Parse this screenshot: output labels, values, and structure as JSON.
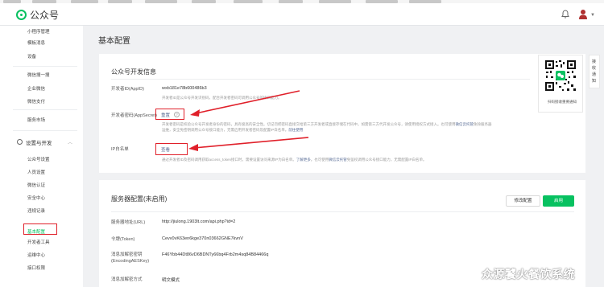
{
  "header": {
    "logo_text": "公众号"
  },
  "sidebar": {
    "items": [
      {
        "label": "小程序管理"
      },
      {
        "label": "模板消息"
      },
      {
        "label": "设备"
      },
      {
        "label": "微信搜一搜"
      },
      {
        "label": "企业微信"
      },
      {
        "label": "微信支付"
      },
      {
        "label": "服务市场"
      },
      {
        "label": "公众号设置"
      },
      {
        "label": "人员设置"
      },
      {
        "label": "微信认证"
      },
      {
        "label": "安全中心"
      },
      {
        "label": "违规记录"
      },
      {
        "label": "基本配置"
      },
      {
        "label": "开发者工具"
      },
      {
        "label": "运维中心"
      },
      {
        "label": "接口权限"
      }
    ],
    "group_label": "设置与开发"
  },
  "page": {
    "title": "基本配置"
  },
  "dev_info": {
    "title": "公众号开发信息",
    "appid_label": "开发者ID(AppID)",
    "appid_value": "wxb181e78b600486b3",
    "appid_desc": "开发者ID是公众号开发识别码，配合开发者密码可调用公众号的接口能力。",
    "secret_label": "开发者密码(AppSecret)",
    "secret_action": "重置",
    "secret_desc_1": "开发者密码是校验公众号开发者身份的密码，具有极高的安全性。切记勿把密码直接交给第三方开发者或直接存储在代码中。如需第三方代开发公众号，请使用授权方式接入。也可使用",
    "secret_desc_link": "微信云托管",
    "secret_desc_2": "免除服务器",
    "secret_desc_3": "运维，安全免密钥调用公众号接口能力，无需启用开发者密码及配置IP白名单。",
    "secret_desc_link2": "前往使用",
    "ip_label": "IP白名单",
    "ip_action": "查看",
    "ip_desc_1": "通过开发者ID及密码调用获取access_token接口时，需要设置访问来源IP为白名单。",
    "ip_desc_link": "了解更多",
    "ip_desc_2": "。也可使用",
    "ip_desc_link2": "微信云托管",
    "ip_desc_3": "免鉴权调用公众号接口能力，无需配置IP白名单。"
  },
  "qr": {
    "caption": "扫码接收重要通知"
  },
  "side_tab": {
    "label": "接收通知"
  },
  "server": {
    "title": "服务器配置(未启用)",
    "btn_modify": "修改配置",
    "btn_enable": "启用",
    "url_label": "服务器地址(URL)",
    "url_value": "http://jiulong.1903lt.com/api.php?id=2",
    "token_label": "令牌(Token)",
    "token_value": "Cevv0vK63en6kge370n03662GNE7kvnV",
    "aes_label": "消息加解密密钥(EncodingAESKey)",
    "aes_value": "F46Ybb44Dt86vD6BDNTy66bq4Frb2m4sq84B84466q",
    "mode_label": "消息加解密方式",
    "mode_value": "明文模式"
  },
  "watermark": "众源饕火餐饮系统",
  "colors": {
    "brand_green": "#07c160",
    "link_blue": "#576b95",
    "annotation_red": "#e0202a"
  }
}
